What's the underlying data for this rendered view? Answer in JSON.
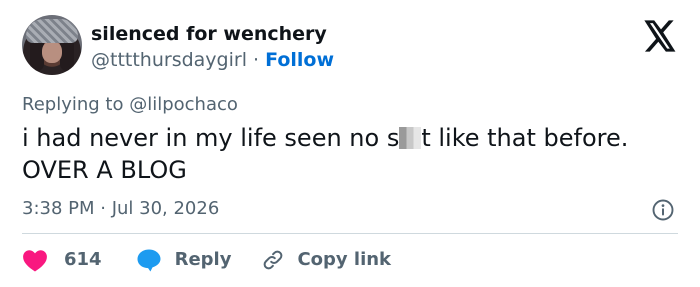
{
  "author": {
    "display_name": "silenced for wenchery",
    "handle": "@tttthursdaygirl",
    "separator": " · ",
    "follow_label": "Follow",
    "avatar_icon": "profile-photo"
  },
  "platform": {
    "logo_icon": "x-logo"
  },
  "tweet": {
    "reply_to": "Replying to @lilpochaco",
    "text_part1": "i had never in my life seen no s",
    "text_part2": "t like that before.",
    "text_line2": "OVER A BLOG",
    "timestamp": "3:38 PM · Jul 30, 2026"
  },
  "actions": {
    "like_count": "614",
    "reply_label": "Reply",
    "copy_link_label": "Copy link"
  },
  "colors": {
    "like": "#f91880",
    "reply": "#1d9bf0",
    "follow": "#006fd6",
    "muted": "#536471",
    "text": "#0f1419",
    "divider": "#cfd9de"
  }
}
